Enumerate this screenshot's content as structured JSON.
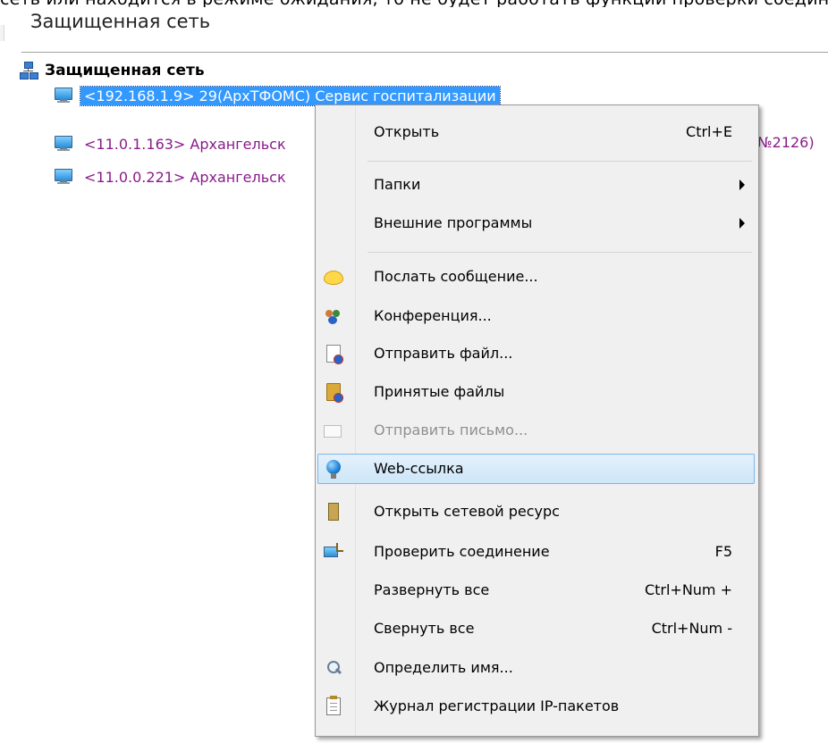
{
  "top_clip_text": "сеть или находится в режиме ожидания, то не будет работать функции проверки соединения",
  "pane": {
    "title": "Защищенная сеть"
  },
  "tree": {
    "root": {
      "icon": "network-icon",
      "label": "Защищенная сеть"
    },
    "items": [
      {
        "icon": "computer-icon",
        "label": "<192.168.1.9> 29(АрхТФОМС) Сервис госпитализации",
        "selected": true
      },
      {
        "icon": "computer-icon",
        "label": "<11.0.1.163> Архангельск",
        "selected": false
      },
      {
        "icon": "computer-icon",
        "label": "<11.0.0.221> Архангельск",
        "selected": false
      }
    ],
    "peek_text": "№2126)"
  },
  "context_menu": {
    "items": [
      {
        "label": "Открыть",
        "shortcut": "Ctrl+E",
        "icon": ""
      },
      {
        "label": "Папки",
        "submenu": true,
        "icon": ""
      },
      {
        "label": "Внешние программы",
        "submenu": true,
        "icon": ""
      },
      {
        "label": "Послать сообщение...",
        "icon": "speech-bubble-icon"
      },
      {
        "label": "Конференция...",
        "icon": "people-icon"
      },
      {
        "label": "Отправить файл...",
        "icon": "send-file-icon"
      },
      {
        "label": "Принятые файлы",
        "icon": "received-files-icon"
      },
      {
        "label": "Отправить письмо...",
        "icon": "mail-icon",
        "disabled": true
      },
      {
        "label": "Web-ссылка",
        "icon": "globe-icon",
        "highlighted": true
      },
      {
        "label": "Открыть сетевой ресурс",
        "icon": "network-share-icon"
      },
      {
        "label": "Проверить соединение",
        "shortcut": "F5",
        "icon": "check-connection-icon"
      },
      {
        "label": "Развернуть все",
        "shortcut": "Ctrl+Num +",
        "icon": ""
      },
      {
        "label": "Свернуть все",
        "shortcut": "Ctrl+Num -",
        "icon": ""
      },
      {
        "label": "Определить имя...",
        "icon": "magnifier-icon"
      },
      {
        "label": "Журнал регистрации IP-пакетов",
        "icon": "clipboard-icon"
      }
    ]
  },
  "colors": {
    "selection": "#3399ff",
    "tree_text": "#8a1a8a",
    "menu_background": "#f0f0f0",
    "menu_highlight": "#cde6f8",
    "disabled_text": "#8f8f8f"
  }
}
